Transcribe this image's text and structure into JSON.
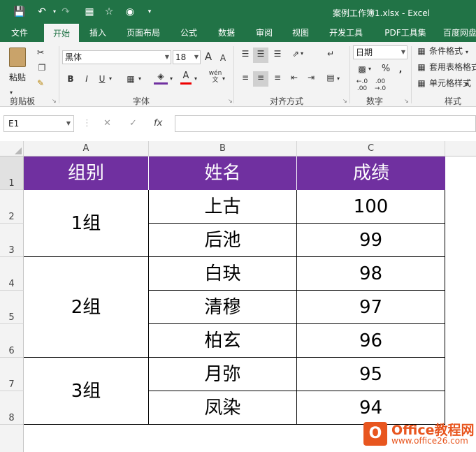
{
  "window": {
    "title": "案例工作簿1.xlsx - Excel"
  },
  "quick_access": {
    "icons": [
      "save-icon",
      "undo-icon",
      "redo-icon",
      "calculator-icon",
      "form-icon",
      "camera-icon",
      "customize-icon"
    ]
  },
  "tabs": [
    "文件",
    "开始",
    "插入",
    "页面布局",
    "公式",
    "数据",
    "审阅",
    "视图",
    "开发工具",
    "PDF工具集",
    "百度网盘"
  ],
  "ribbon": {
    "clipboard": {
      "paste_label": "粘贴",
      "group_label": "剪贴板"
    },
    "font": {
      "family": "黑体",
      "size": "18",
      "group_label": "字体",
      "bold": "B",
      "italic": "I",
      "underline": "U",
      "grow": "A",
      "shrink": "A",
      "wen": "wén",
      "font_color": "A"
    },
    "alignment": {
      "group_label": "对齐方式"
    },
    "number": {
      "format": "日期",
      "group_label": "数字",
      "percent": "%",
      "comma": ","
    },
    "styles": {
      "conditional": "条件格式",
      "table": "套用表格格式",
      "cell": "单元格样式",
      "group_label": "样式"
    }
  },
  "formula_bar": {
    "name_box": "E1",
    "fx": "fx",
    "value": ""
  },
  "sheet": {
    "columns": [
      "A",
      "B",
      "C"
    ],
    "rows": [
      "1",
      "2",
      "3",
      "4",
      "5",
      "6",
      "7",
      "8"
    ],
    "header": [
      "组别",
      "姓名",
      "成绩"
    ],
    "header_bg": "#7030a0",
    "groups": [
      {
        "name": "1组",
        "members": [
          {
            "name": "上古",
            "score": "100"
          },
          {
            "name": "后池",
            "score": "99"
          }
        ]
      },
      {
        "name": "2组",
        "members": [
          {
            "name": "白玦",
            "score": "98"
          },
          {
            "name": "清穆",
            "score": "97"
          },
          {
            "name": "柏玄",
            "score": "96"
          }
        ]
      },
      {
        "name": "3组",
        "members": [
          {
            "name": "月弥",
            "score": "95"
          },
          {
            "name": "凤染",
            "score": "94"
          }
        ]
      }
    ]
  },
  "watermark": {
    "name": "Office教程网",
    "url": "www.office26.com"
  }
}
